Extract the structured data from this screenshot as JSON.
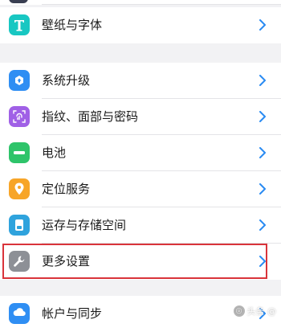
{
  "groups": [
    {
      "items": [
        {
          "label": "壁纸与字体",
          "icon": "wallpaper-font-icon",
          "color": "#18c7c2"
        }
      ]
    },
    {
      "items": [
        {
          "label": "系统升级",
          "icon": "system-update-icon",
          "color": "#2f8ef3"
        },
        {
          "label": "指纹、面部与密码",
          "icon": "fingerprint-icon",
          "color": "#a060e6"
        },
        {
          "label": "电池",
          "icon": "battery-icon",
          "color": "#2ec46a"
        },
        {
          "label": "定位服务",
          "icon": "location-icon",
          "color": "#f7a528"
        },
        {
          "label": "运存与存储空间",
          "icon": "storage-icon",
          "color": "#2fa3dd"
        },
        {
          "label": "更多设置",
          "icon": "wrench-icon",
          "color": "#8d9096"
        }
      ]
    },
    {
      "items": [
        {
          "label": "帐户与同步",
          "icon": "account-sync-icon",
          "color": "#2f8ef3"
        }
      ]
    }
  ],
  "highlighted_item": "更多设置",
  "watermark": "头条 @"
}
